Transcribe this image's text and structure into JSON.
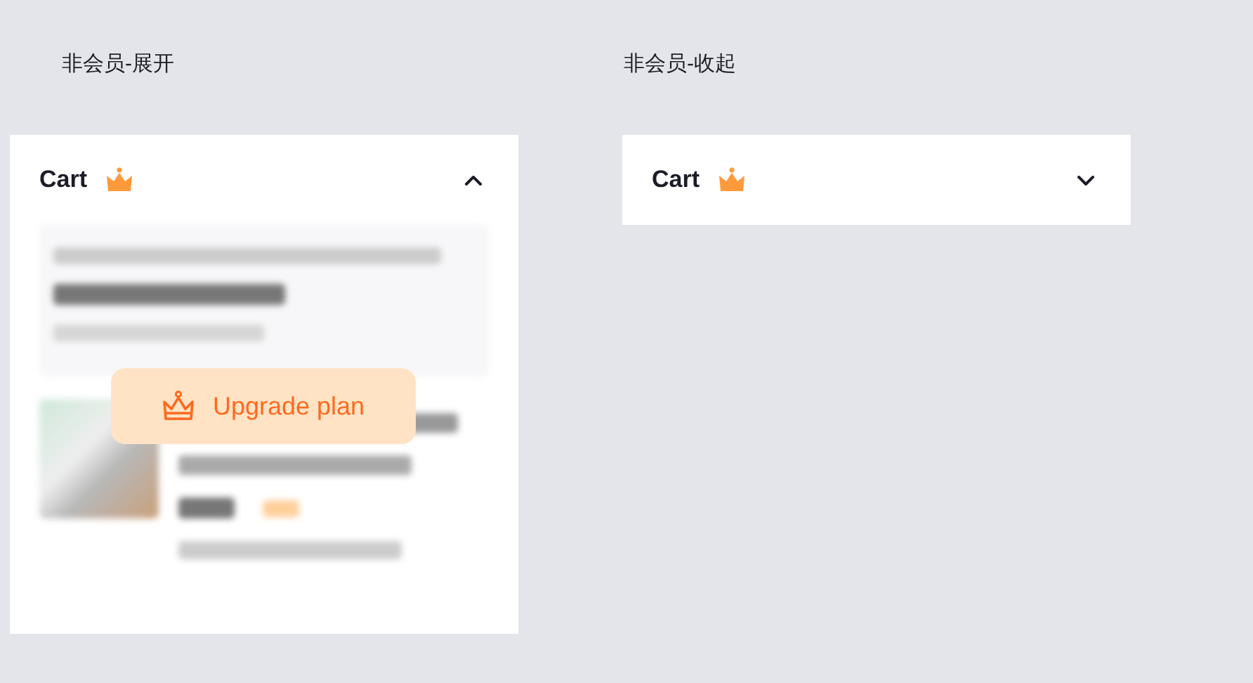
{
  "panels": [
    {
      "caption": "非会员-展开",
      "title": "Cart",
      "expanded": true,
      "upgrade_button": "Upgrade plan"
    },
    {
      "caption": "非会员-收起",
      "title": "Cart",
      "expanded": false
    }
  ]
}
